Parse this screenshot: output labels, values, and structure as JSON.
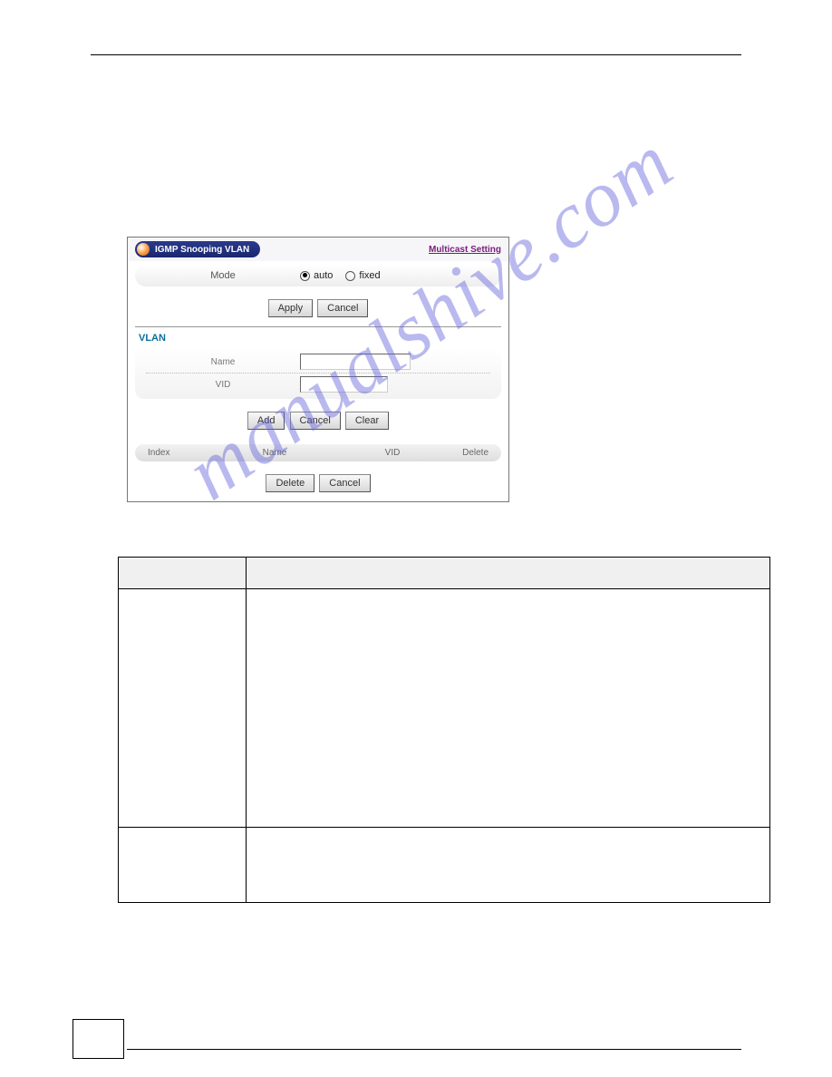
{
  "panel": {
    "title": "IGMP Snooping VLAN",
    "right_link": "Multicast Setting",
    "mode_label": "Mode",
    "mode_option_auto": "auto",
    "mode_option_fixed": "fixed",
    "apply_label": "Apply",
    "cancel_label": "Cancel",
    "vlan_section": "VLAN",
    "name_label": "Name",
    "vid_label": "VID",
    "add_label": "Add",
    "cancel2_label": "Cancel",
    "clear_label": "Clear",
    "th_index": "Index",
    "th_name": "Name",
    "th_vid": "VID",
    "th_delete": "Delete",
    "delete_label": "Delete",
    "cancel3_label": "Cancel"
  },
  "watermark": "manualshive.com"
}
